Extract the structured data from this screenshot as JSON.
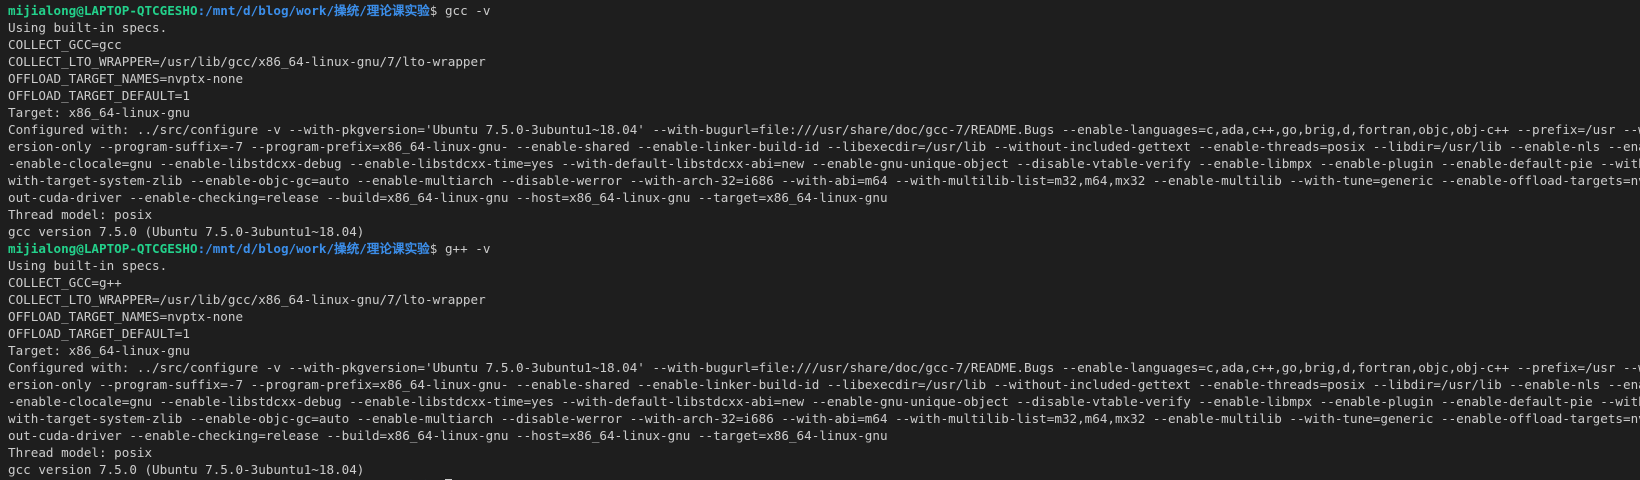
{
  "prompt": {
    "user_host": "mijialong@LAPTOP-QTCGESHO",
    "path": ":/mnt/d/blog/work/操统/理论课实验",
    "symbol": "$ "
  },
  "blocks": [
    {
      "command": "gcc -v",
      "output": [
        "Using built-in specs.",
        "COLLECT_GCC=gcc",
        "COLLECT_LTO_WRAPPER=/usr/lib/gcc/x86_64-linux-gnu/7/lto-wrapper",
        "OFFLOAD_TARGET_NAMES=nvptx-none",
        "OFFLOAD_TARGET_DEFAULT=1",
        "Target: x86_64-linux-gnu",
        "Configured with: ../src/configure -v --with-pkgversion='Ubuntu 7.5.0-3ubuntu1~18.04' --with-bugurl=file:///usr/share/doc/gcc-7/README.Bugs --enable-languages=c,ada,c++,go,brig,d,fortran,objc,obj-c++ --prefix=/usr --with-gcc-major-v",
        "ersion-only --program-suffix=-7 --program-prefix=x86_64-linux-gnu- --enable-shared --enable-linker-build-id --libexecdir=/usr/lib --without-included-gettext --enable-threads=posix --libdir=/usr/lib --enable-nls --enable-bootstrap -",
        "-enable-clocale=gnu --enable-libstdcxx-debug --enable-libstdcxx-time=yes --with-default-libstdcxx-abi=new --enable-gnu-unique-object --disable-vtable-verify --enable-libmpx --enable-plugin --enable-default-pie --with-system-zlib --",
        "with-target-system-zlib --enable-objc-gc=auto --enable-multiarch --disable-werror --with-arch-32=i686 --with-abi=m64 --with-multilib-list=m32,m64,mx32 --enable-multilib --with-tune=generic --enable-offload-targets=nvptx-none --with",
        "out-cuda-driver --enable-checking=release --build=x86_64-linux-gnu --host=x86_64-linux-gnu --target=x86_64-linux-gnu",
        "Thread model: posix",
        "gcc version 7.5.0 (Ubuntu 7.5.0-3ubuntu1~18.04)"
      ]
    },
    {
      "command": "g++ -v",
      "output": [
        "Using built-in specs.",
        "COLLECT_GCC=g++",
        "COLLECT_LTO_WRAPPER=/usr/lib/gcc/x86_64-linux-gnu/7/lto-wrapper",
        "OFFLOAD_TARGET_NAMES=nvptx-none",
        "OFFLOAD_TARGET_DEFAULT=1",
        "Target: x86_64-linux-gnu",
        "Configured with: ../src/configure -v --with-pkgversion='Ubuntu 7.5.0-3ubuntu1~18.04' --with-bugurl=file:///usr/share/doc/gcc-7/README.Bugs --enable-languages=c,ada,c++,go,brig,d,fortran,objc,obj-c++ --prefix=/usr --with-gcc-major-v",
        "ersion-only --program-suffix=-7 --program-prefix=x86_64-linux-gnu- --enable-shared --enable-linker-build-id --libexecdir=/usr/lib --without-included-gettext --enable-threads=posix --libdir=/usr/lib --enable-nls --enable-bootstrap -",
        "-enable-clocale=gnu --enable-libstdcxx-debug --enable-libstdcxx-time=yes --with-default-libstdcxx-abi=new --enable-gnu-unique-object --disable-vtable-verify --enable-libmpx --enable-plugin --enable-default-pie --with-system-zlib --",
        "with-target-system-zlib --enable-objc-gc=auto --enable-multiarch --disable-werror --with-arch-32=i686 --with-abi=m64 --with-multilib-list=m32,m64,mx32 --enable-multilib --with-tune=generic --enable-offload-targets=nvptx-none --with",
        "out-cuda-driver --enable-checking=release --build=x86_64-linux-gnu --host=x86_64-linux-gnu --target=x86_64-linux-gnu",
        "Thread model: posix",
        "gcc version 7.5.0 (Ubuntu 7.5.0-3ubuntu1~18.04)"
      ]
    }
  ],
  "colors": {
    "background": "#1e1e1e",
    "text": "#cccccc",
    "user_host": "#23d18b",
    "path": "#3b8eea"
  }
}
